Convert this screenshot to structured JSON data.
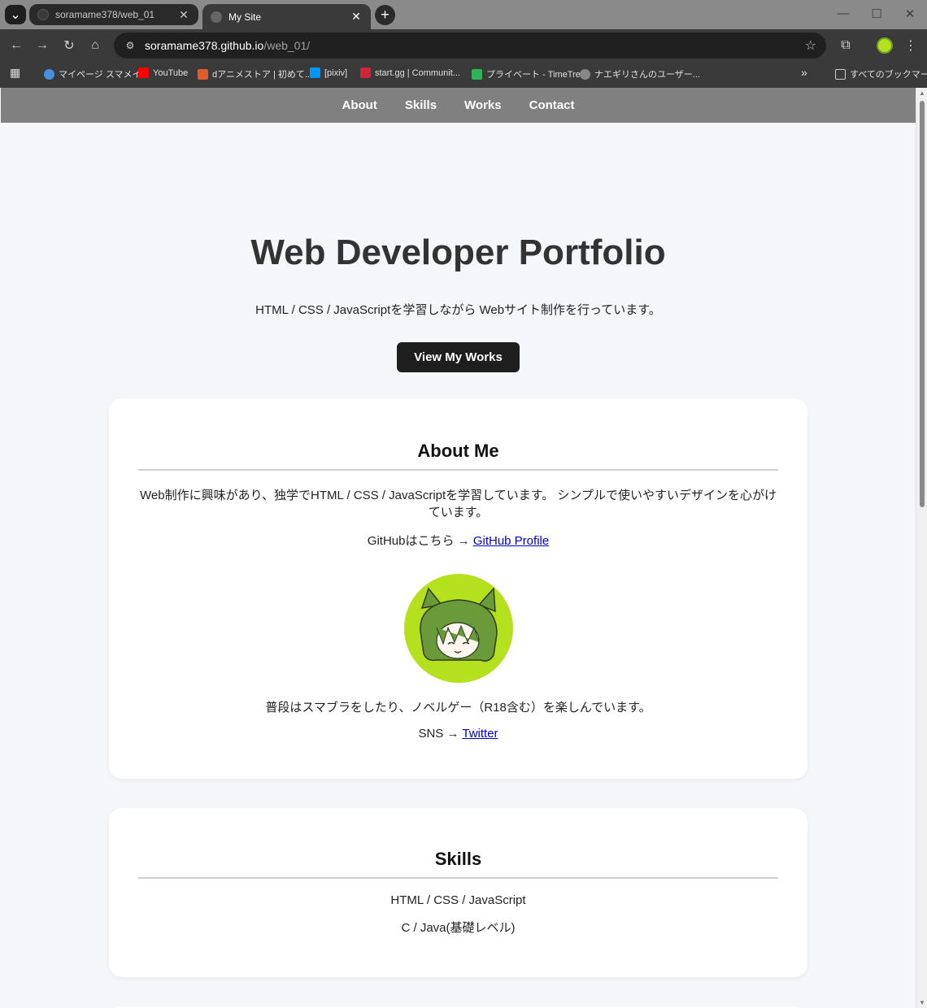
{
  "browser": {
    "tabs": [
      {
        "title": "soramame378/web_01",
        "active": false
      },
      {
        "title": "My Site",
        "active": true
      }
    ],
    "url_host": "soramame378.github.io",
    "url_path": "/web_01/",
    "bookmarks": [
      {
        "label": "マイページ スマメイト",
        "color": "#4a90d9"
      },
      {
        "label": "YouTube",
        "color": "#ff0000"
      },
      {
        "label": "dアニメストア | 初めて...",
        "color": "#e05a2a"
      },
      {
        "label": "[pixiv]",
        "color": "#0096fa"
      },
      {
        "label": "start.gg | Communit...",
        "color": "#d0243a"
      },
      {
        "label": "プライベート - TimeTree",
        "color": "#2fb35a"
      },
      {
        "label": "ナエギリさんのユーザー...",
        "color": "#888888"
      }
    ],
    "all_bookmarks": "すべてのブックマーク"
  },
  "site": {
    "nav": [
      "About",
      "Skills",
      "Works",
      "Contact"
    ],
    "hero": {
      "title": "Web Developer Portfolio",
      "subtitle": "HTML / CSS / JavaScriptを学習しながら Webサイト制作を行っています。",
      "cta": "View My Works"
    },
    "about": {
      "heading": "About Me",
      "intro": "Web制作に興味があり、独学でHTML / CSS / JavaScriptを学習しています。 シンプルで使いやすいデザインを心がけています。",
      "github_prefix": "GitHubはこちら → ",
      "github_link": "GitHub Profile",
      "hobby": "普段はスマブラをしたり、ノベルゲー（R18含む）を楽しんでいます。",
      "sns_prefix": "SNS → ",
      "sns_link": "Twitter"
    },
    "skills": {
      "heading": "Skills",
      "items": [
        "HTML / CSS / JavaScript",
        "C / Java(基礎レベル)"
      ]
    }
  },
  "colors": {
    "nav_bg": "#808080",
    "page_bg": "#f5f6f9",
    "cta_bg": "#1e1e1e",
    "avatar_bg": "#b4e01e",
    "link": "#0000cc"
  }
}
